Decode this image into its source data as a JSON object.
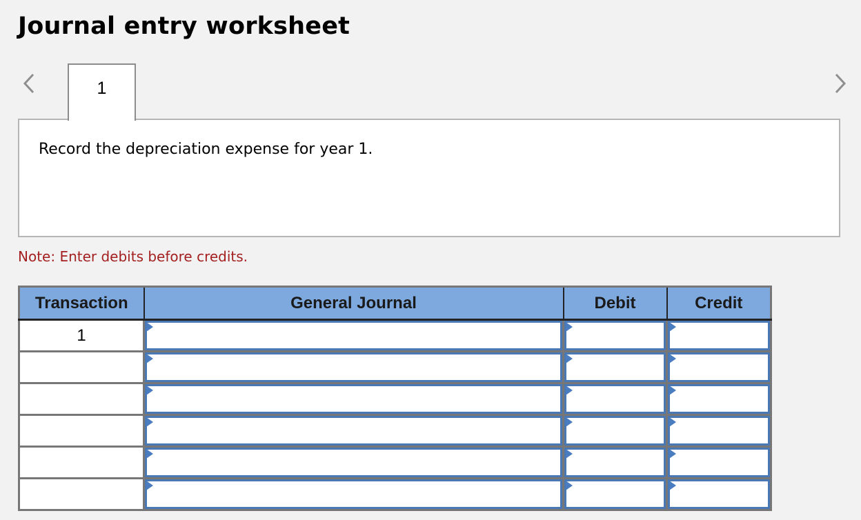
{
  "page": {
    "title": "Journal entry worksheet"
  },
  "navigation": {
    "prev_icon": "chevron-left-icon",
    "next_icon": "chevron-right-icon",
    "tabs": [
      {
        "label": "1",
        "active": true
      }
    ]
  },
  "instruction": {
    "text": "Record the depreciation expense for year 1."
  },
  "note": {
    "text": "Note: Enter debits before credits.",
    "color": "#a42020"
  },
  "journal": {
    "headers": {
      "transaction": "Transaction",
      "general_journal": "General Journal",
      "debit": "Debit",
      "credit": "Credit"
    },
    "header_color": "#7ea9df",
    "input_border_color": "#4a78b5",
    "rows": [
      {
        "transaction": "1",
        "account": "",
        "debit": "",
        "credit": ""
      },
      {
        "transaction": "",
        "account": "",
        "debit": "",
        "credit": ""
      },
      {
        "transaction": "",
        "account": "",
        "debit": "",
        "credit": ""
      },
      {
        "transaction": "",
        "account": "",
        "debit": "",
        "credit": ""
      },
      {
        "transaction": "",
        "account": "",
        "debit": "",
        "credit": ""
      },
      {
        "transaction": "",
        "account": "",
        "debit": "",
        "credit": ""
      }
    ]
  }
}
